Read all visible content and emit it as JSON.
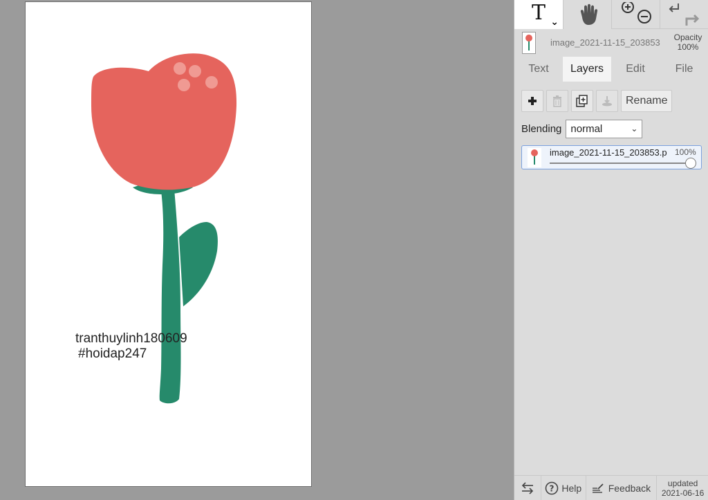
{
  "canvas": {
    "text_line1": "tranthuylinh180609",
    "text_line2": "#hoidap247",
    "colors": {
      "petal": "#e5645d",
      "petal_dots": "#f09a93",
      "stem": "#268a6b",
      "background": "#ffffff"
    }
  },
  "toolbar": {
    "text_tool_glyph": "T",
    "text_tool_caret": "⌄",
    "icons": [
      "text-tool-icon",
      "hand-icon",
      "zoom-in-icon",
      "zoom-out-icon",
      "undo-icon",
      "redo-icon"
    ]
  },
  "document": {
    "name": "image_2021-11-15_203853",
    "opacity_label": "Opacity",
    "opacity_value": "100%"
  },
  "tabs": [
    {
      "label": "Text",
      "active": false
    },
    {
      "label": "Layers",
      "active": true
    },
    {
      "label": "Edit",
      "active": false
    },
    {
      "label": "File",
      "active": false
    }
  ],
  "layer_tools": {
    "rename_label": "Rename",
    "icons": [
      "add-layer-icon",
      "delete-layer-icon",
      "duplicate-layer-icon",
      "merge-down-icon"
    ]
  },
  "blending": {
    "label": "Blending",
    "selected": "normal"
  },
  "layers": [
    {
      "name": "image_2021-11-15_203853.p",
      "opacity": "100%",
      "opacity_fraction": 1.0
    }
  ],
  "footer": {
    "help_label": "Help",
    "feedback_label": "Feedback",
    "updated_label": "updated",
    "updated_date": "2021-06-16"
  }
}
